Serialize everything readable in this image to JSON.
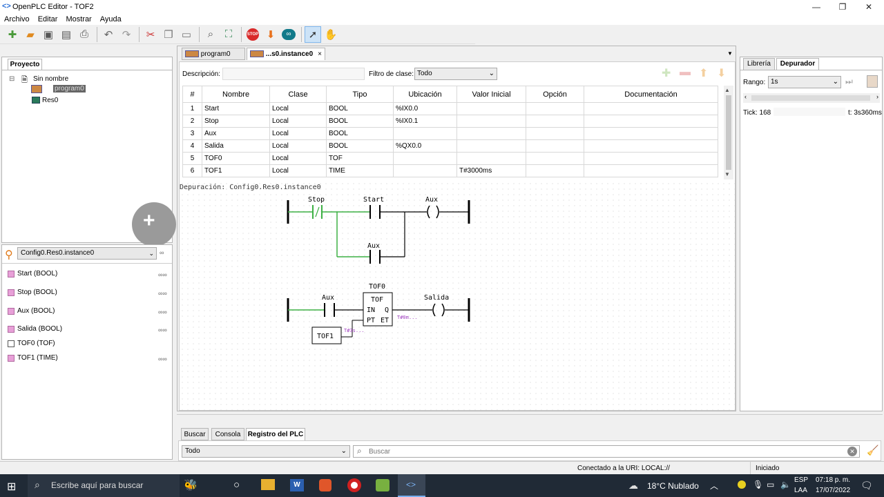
{
  "window": {
    "title": "OpenPLC Editor - TOF2"
  },
  "menu": [
    "Archivo",
    "Editar",
    "Mostrar",
    "Ayuda"
  ],
  "project": {
    "tab": "Proyecto",
    "root": "Sin nombre",
    "program": "program0",
    "resource": "Res0"
  },
  "instance_select": "Config0.Res0.instance0",
  "var_list": [
    "Start (BOOL)",
    "Stop (BOOL)",
    "Aux (BOOL)",
    "Salida (BOOL)",
    "TOF0 (TOF)",
    "TOF1 (TIME)"
  ],
  "editor": {
    "tabs": [
      "program0",
      "...s0.instance0"
    ],
    "desc_label": "Descripción:",
    "filter_label": "Filtro de clase:",
    "filter_value": "Todo",
    "columns": [
      "#",
      "Nombre",
      "Clase",
      "Tipo",
      "Ubicación",
      "Valor Inicial",
      "Opción",
      "Documentación"
    ],
    "rows": [
      [
        "1",
        "Start",
        "Local",
        "BOOL",
        "%IX0.0",
        "",
        "",
        ""
      ],
      [
        "2",
        "Stop",
        "Local",
        "BOOL",
        "%IX0.1",
        "",
        "",
        ""
      ],
      [
        "3",
        "Aux",
        "Local",
        "BOOL",
        "",
        "",
        "",
        ""
      ],
      [
        "4",
        "Salida",
        "Local",
        "BOOL",
        "%QX0.0",
        "",
        "",
        ""
      ],
      [
        "5",
        "TOF0",
        "Local",
        "TOF",
        "",
        "",
        "",
        ""
      ],
      [
        "6",
        "TOF1",
        "Local",
        "TIME",
        "",
        "T#3000ms",
        "",
        ""
      ]
    ],
    "debug_label": "Depuración: Config0.Res0.instance0"
  },
  "ladder": {
    "rung1": {
      "stop": "Stop",
      "start": "Start",
      "aux_coil": "Aux",
      "aux_contact": "Aux"
    },
    "rung2": {
      "aux": "Aux",
      "block_name": "TOF0",
      "block_type": "TOF",
      "in": "IN",
      "q": "Q",
      "pt": "PT",
      "et": "ET",
      "output": "Salida",
      "pt_var": "TOF1",
      "pt_val": "T#3s...",
      "et_val": "T#0m..."
    }
  },
  "right": {
    "tabs": [
      "Librería",
      "Depurador"
    ],
    "range_label": "Rango:",
    "range_value": "1s",
    "tick": "Tick: 168",
    "time": "t: 3s360ms"
  },
  "bottom": {
    "tabs": [
      "Buscar",
      "Consola",
      "Registro del PLC"
    ],
    "level": "Todo",
    "search_placeholder": "Buscar"
  },
  "status": {
    "uri": "Conectado a la URI: LOCAL://",
    "state": "Iniciado"
  },
  "taskbar": {
    "search": "Escribe aquí para buscar",
    "weather": "18°C  Nublado",
    "lang1": "ESP",
    "lang2": "LAA",
    "time": "07:18 p. m.",
    "date": "17/07/2022"
  },
  "colors": {
    "energized": "#3cb043",
    "accent": "#2a6fd6"
  }
}
